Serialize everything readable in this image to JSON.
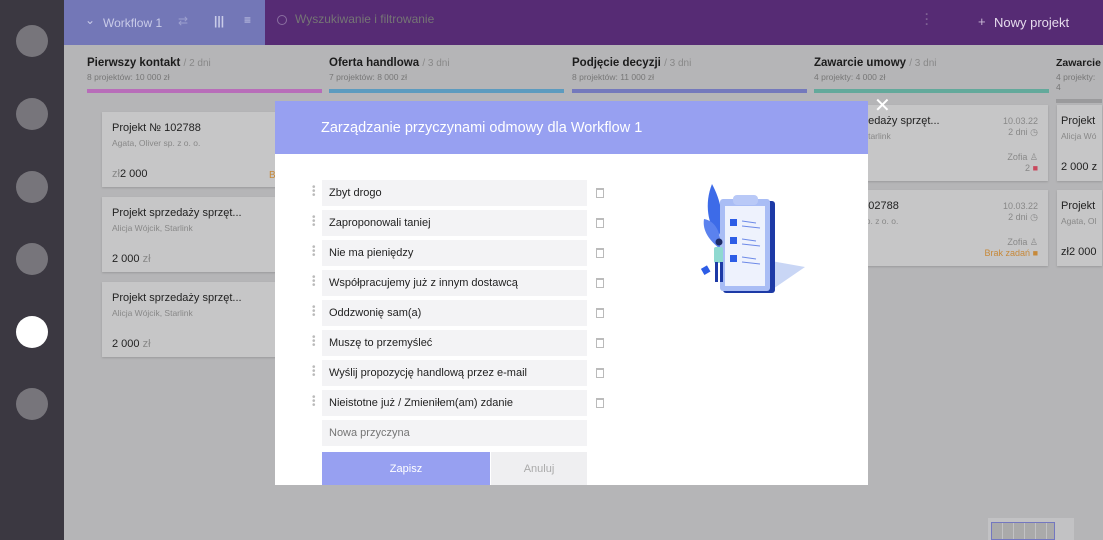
{
  "header": {
    "workflow": "Workflow 1",
    "search_placeholder": "Wyszukiwanie i filtrowanie",
    "new_project": "Nowy projekt"
  },
  "columns": [
    {
      "title": "Pierwszy kontakt",
      "days": "/ 2 dni",
      "summary": "8 projektów: 10 000 zł",
      "color": "#b86db9"
    },
    {
      "title": "Oferta handlowa",
      "days": "/ 3 dni",
      "summary": "7 projektów: 8 000 zł",
      "color": "#5c9bbf"
    },
    {
      "title": "Podjęcie decyzji",
      "days": "/ 3 dni",
      "summary": "8 projektów: 11 000 zł",
      "color": "#7479bc"
    },
    {
      "title": "Zawarcie umowy",
      "days": "/ 3 dni",
      "summary": "4 projekty: 4 000 zł",
      "color": "#63a99b"
    },
    {
      "title": "Zawarcie",
      "days": "",
      "summary": "4 projekty: 4",
      "color": "#9a9a9c"
    }
  ],
  "cards_col1": [
    {
      "title": "Projekt № 102788",
      "sub": "Agata, Oliver sp. z o. o.",
      "price": "2 000",
      "cur": "zł",
      "badge": "B"
    },
    {
      "title": "Projekt sprzedaży sprzęt...",
      "sub": "Alicja Wójcik, Starlink",
      "price": "2 000",
      "cur": "zł"
    },
    {
      "title": "Projekt sprzedaży sprzęt...",
      "sub": "Alicja Wójcik, Starlink",
      "price": "2 000",
      "cur": "zł"
    }
  ],
  "cards_col4": [
    {
      "title": "Projekt sprzedaży sprzęt...",
      "sub": "Alicja Wójcik, Starlink",
      "date": "10.03.22",
      "dur": "2 dni",
      "user": "Zofia",
      "tasks": "2"
    },
    {
      "title": "Projekt № 102788",
      "sub": "Agata, Oliver sp. z o. o.",
      "date": "10.03.22",
      "dur": "2 dni",
      "user": "Zofia",
      "tasks": "Brak zadań"
    }
  ],
  "cards_col5": [
    {
      "title": "Projekt",
      "sub": "Alicja Wó",
      "price": "2 000 z"
    },
    {
      "title": "Projekt",
      "sub": "Agata, Ol",
      "price": "zł2 000"
    }
  ],
  "modal": {
    "title": "Zarządzanie przyczynami odmowy dla Workflow 1",
    "reasons": [
      "Zbyt drogo",
      "Zaproponowali taniej",
      "Nie ma pieniędzy",
      "Współpracujemy już z innym dostawcą",
      "Oddzwonię sam(a)",
      "Muszę to przemyśleć",
      "Wyślij propozycję handlową przez e-mail",
      "Nieistotne już / Zmieniłem(am) zdanie"
    ],
    "new_placeholder": "Nowa przyczyna",
    "save": "Zapisz",
    "cancel": "Anuluj"
  },
  "colors": {
    "accent": "#97a0f1",
    "header": "#562b74"
  }
}
